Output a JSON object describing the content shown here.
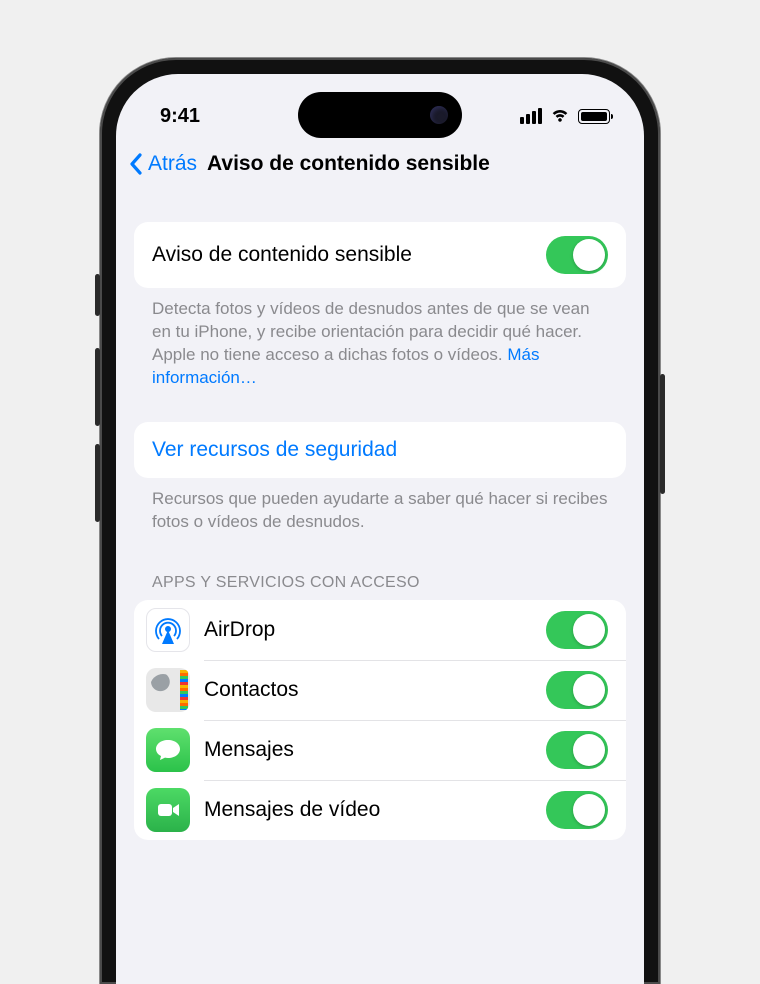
{
  "status": {
    "time": "9:41"
  },
  "nav": {
    "back": "Atrás",
    "title": "Aviso de contenido sensible"
  },
  "main_toggle": {
    "label": "Aviso de contenido sensible",
    "on": true
  },
  "main_footer": "Detecta fotos y vídeos de desnudos antes de que se vean en tu iPhone, y recibe orientación para decidir qué hacer. Apple no tiene acceso a dichas fotos o vídeos. ",
  "main_footer_link": "Más información…",
  "resources": {
    "link": "Ver recursos de seguridad",
    "footer": "Recursos que pueden ayudarte a saber qué hacer si recibes fotos o vídeos de desnudos."
  },
  "apps_section": {
    "header": "APPS Y SERVICIOS CON ACCESO"
  },
  "apps": [
    {
      "name": "AirDrop",
      "on": true,
      "icon": "airdrop"
    },
    {
      "name": "Contactos",
      "on": true,
      "icon": "contacts"
    },
    {
      "name": "Mensajes",
      "on": true,
      "icon": "messages"
    },
    {
      "name": "Mensajes de vídeo",
      "on": true,
      "icon": "video"
    }
  ]
}
